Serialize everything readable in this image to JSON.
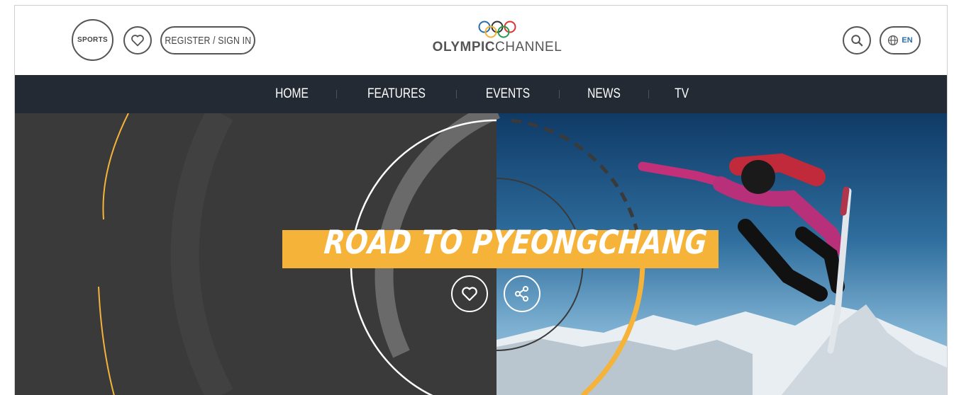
{
  "header": {
    "sports_label": "SPORTS",
    "register_label": "REGISTER / SIGN IN",
    "logo": {
      "bold": "OLYMPIC",
      "rest": "CHANNEL"
    },
    "language": "EN"
  },
  "nav": {
    "items": [
      {
        "label": "HOME"
      },
      {
        "label": "FEATURES"
      },
      {
        "label": "EVENTS"
      },
      {
        "label": "NEWS"
      },
      {
        "label": "TV"
      }
    ]
  },
  "hero": {
    "title": "ROAD TO PYEONGCHANG"
  },
  "colors": {
    "accent": "#f5b339",
    "nav_bg": "#232a34",
    "hero_dark": "#3a3a3a",
    "lang_blue": "#2a6ea8"
  },
  "icons": {
    "favorite": "heart-icon",
    "search": "search-icon",
    "language": "globe-icon",
    "share": "share-icon",
    "logo": "olympic-rings-icon"
  }
}
